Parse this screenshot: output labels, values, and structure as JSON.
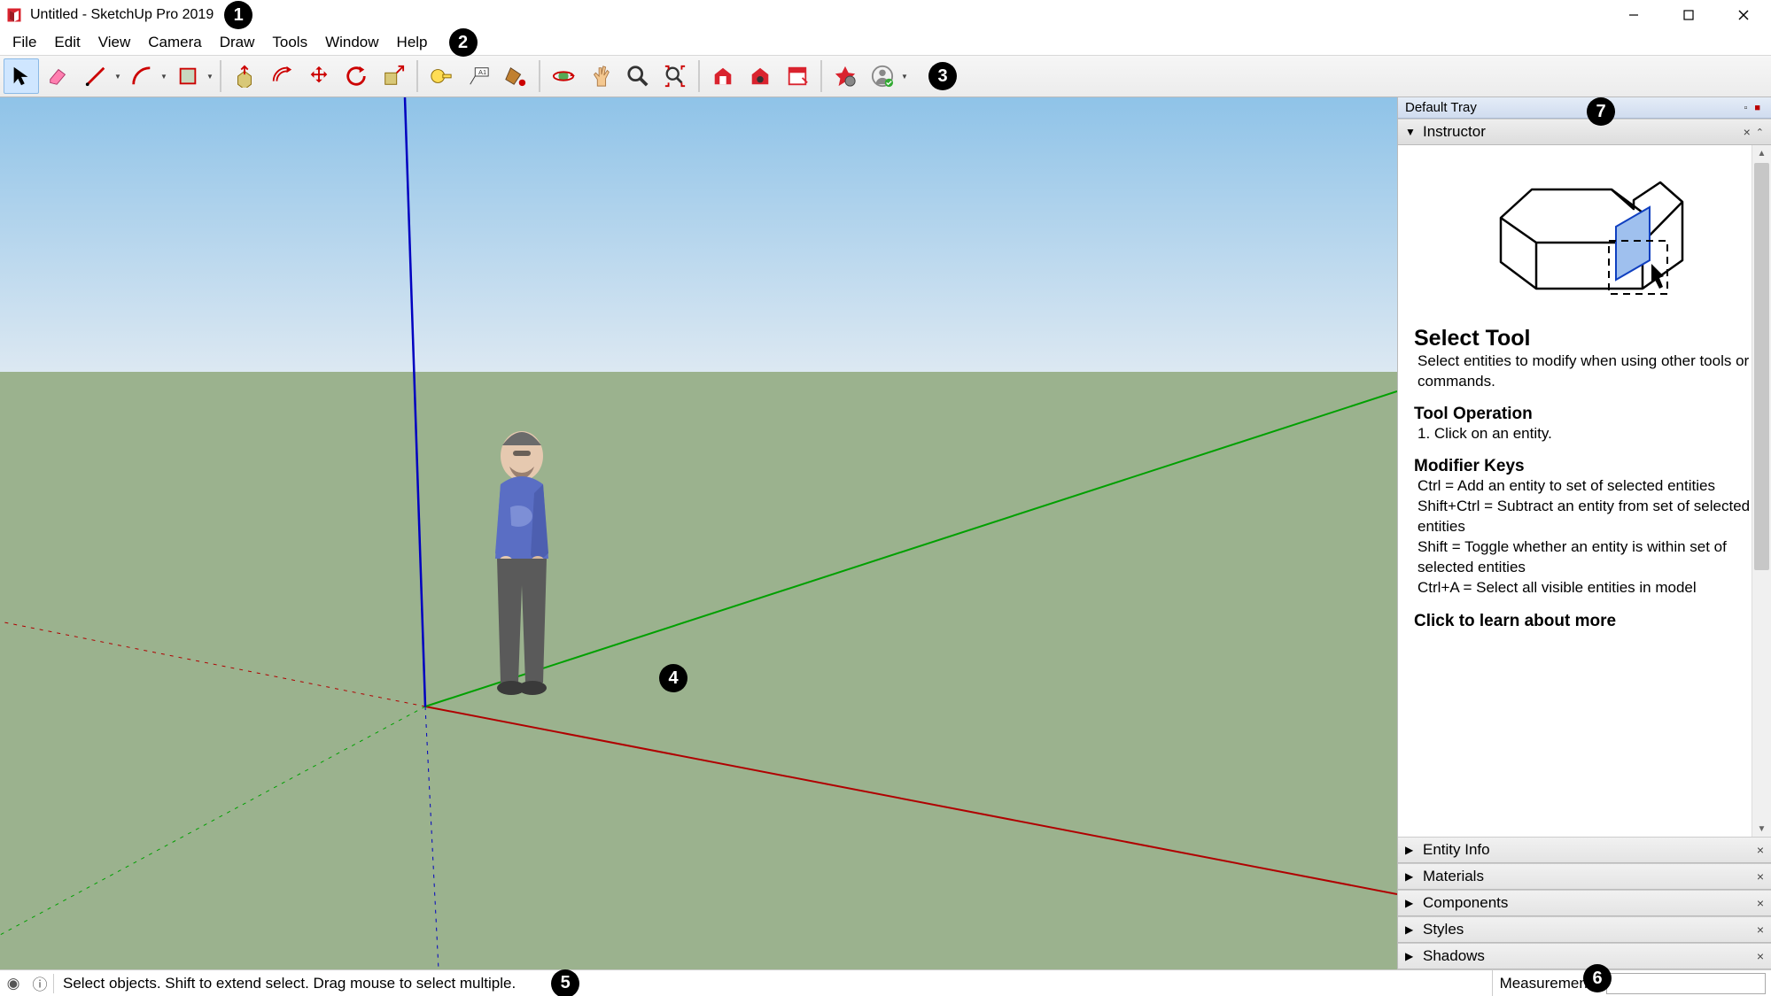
{
  "title": "Untitled - SketchUp Pro 2019",
  "menus": [
    "File",
    "Edit",
    "View",
    "Camera",
    "Draw",
    "Tools",
    "Window",
    "Help"
  ],
  "tools": [
    {
      "name": "select-tool",
      "label": "Select",
      "selected": true
    },
    {
      "name": "eraser-tool",
      "label": "Eraser"
    },
    {
      "name": "line-tool",
      "label": "Lines",
      "dropdown": true
    },
    {
      "name": "arc-tool",
      "label": "Arcs",
      "dropdown": true
    },
    {
      "name": "shape-tool",
      "label": "Shapes",
      "dropdown": true
    },
    {
      "name": "sep"
    },
    {
      "name": "pushpull-tool",
      "label": "Push/Pull"
    },
    {
      "name": "offset-tool",
      "label": "Offset"
    },
    {
      "name": "move-tool",
      "label": "Move"
    },
    {
      "name": "rotate-tool",
      "label": "Rotate"
    },
    {
      "name": "scale-tool",
      "label": "Scale"
    },
    {
      "name": "sep"
    },
    {
      "name": "tape-tool",
      "label": "Tape Measure"
    },
    {
      "name": "text-tool",
      "label": "Text"
    },
    {
      "name": "paint-tool",
      "label": "Paint Bucket"
    },
    {
      "name": "sep"
    },
    {
      "name": "orbit-tool",
      "label": "Orbit"
    },
    {
      "name": "pan-tool",
      "label": "Pan"
    },
    {
      "name": "zoom-tool",
      "label": "Zoom"
    },
    {
      "name": "zoom-extents-tool",
      "label": "Zoom Extents"
    },
    {
      "name": "sep"
    },
    {
      "name": "warehouse-tool",
      "label": "3D Warehouse"
    },
    {
      "name": "extension-warehouse-tool",
      "label": "Extension Warehouse"
    },
    {
      "name": "layout-tool",
      "label": "LayOut"
    },
    {
      "name": "sep"
    },
    {
      "name": "extension-manager-tool",
      "label": "Extension Manager"
    },
    {
      "name": "signin-tool",
      "label": "Sign In",
      "dropdown": true
    }
  ],
  "tray": {
    "title": "Default Tray",
    "instructor": {
      "label": "Instructor",
      "tool_title": "Select Tool",
      "tool_desc": "Select entities to modify when using other tools or commands.",
      "operation_title": "Tool Operation",
      "operation_step": "1. Click on an entity.",
      "modifier_title": "Modifier Keys",
      "mod_ctrl": "Ctrl = Add an entity to set of selected entities",
      "mod_shiftctrl": "Shift+Ctrl = Subtract an entity from set of selected entities",
      "mod_shift": "Shift = Toggle whether an entity is within set of selected entities",
      "mod_ctrla": "Ctrl+A = Select all visible entities in model",
      "learn_more": "Click to learn about more"
    },
    "panels": [
      "Entity Info",
      "Materials",
      "Components",
      "Styles",
      "Shadows"
    ]
  },
  "status": {
    "hint": "Select objects. Shift to extend select. Drag mouse to select multiple.",
    "measurements_label": "Measurements"
  },
  "callouts": [
    "1",
    "2",
    "3",
    "4",
    "5",
    "6",
    "7"
  ]
}
